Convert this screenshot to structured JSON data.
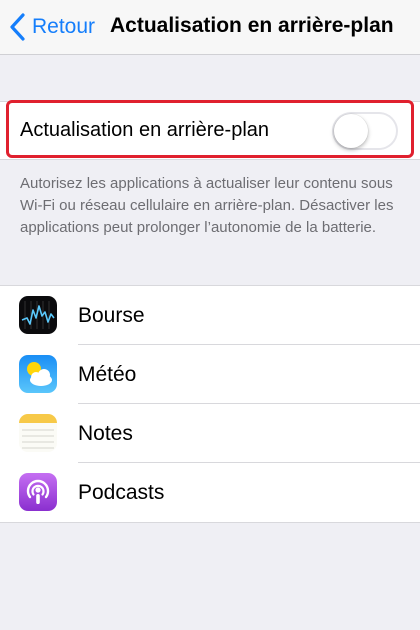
{
  "nav": {
    "back_label": "Retour",
    "title": "Actualisation en arrière-plan",
    "accent_color": "#157efb"
  },
  "toggle": {
    "label": "Actualisation en arrière-plan",
    "state": "off",
    "highlight_color": "#e0202e"
  },
  "description": "Autorisez les applications à actualiser leur contenu sous Wi-Fi ou réseau cellulaire en arrière-plan. Désactiver les applications peut prolonger l’autonomie de la batterie.",
  "apps": [
    {
      "label": "Bourse",
      "icon": "stocks-icon"
    },
    {
      "label": "Météo",
      "icon": "weather-icon"
    },
    {
      "label": "Notes",
      "icon": "notes-icon"
    },
    {
      "label": "Podcasts",
      "icon": "podcasts-icon"
    }
  ]
}
